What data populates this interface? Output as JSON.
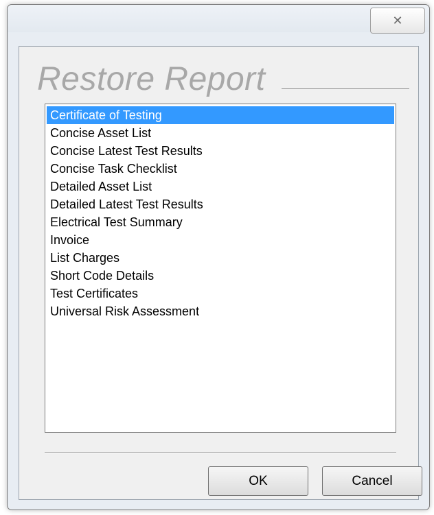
{
  "dialog": {
    "heading": "Restore Report",
    "close_glyph": "☒",
    "close_icon": "close-icon"
  },
  "report_list": {
    "selected_index": 0,
    "items": [
      "Certificate of Testing",
      "Concise Asset List",
      "Concise Latest Test Results",
      "Concise Task Checklist",
      "Detailed Asset List",
      "Detailed Latest Test Results",
      "Electrical Test Summary",
      "Invoice",
      "List Charges",
      "Short Code Details",
      "Test Certificates",
      "Universal Risk Assessment"
    ]
  },
  "buttons": {
    "ok_label": "OK",
    "cancel_label": "Cancel"
  },
  "colors": {
    "selection": "#3399ff",
    "heading": "#a8a8a8"
  }
}
